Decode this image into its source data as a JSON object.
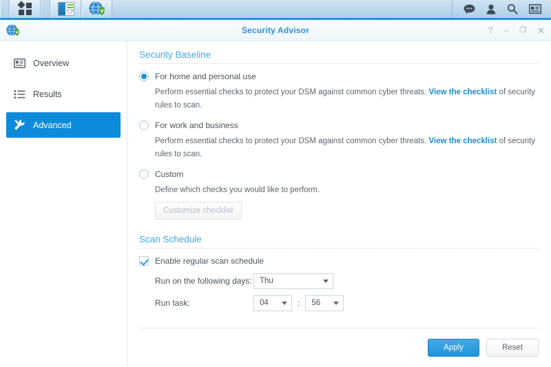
{
  "taskbar": {
    "items": [
      {
        "name": "main-menu",
        "icon": "grid-icon"
      },
      {
        "name": "file-station-window",
        "icon": "document-window-icon"
      },
      {
        "name": "security-advisor-window",
        "icon": "security-advisor-icon"
      }
    ],
    "tray": [
      {
        "name": "notifications",
        "icon": "chat-bubble-icon"
      },
      {
        "name": "user-options",
        "icon": "person-icon"
      },
      {
        "name": "search",
        "icon": "search-icon"
      },
      {
        "name": "widgets",
        "icon": "widget-card-icon"
      }
    ]
  },
  "window": {
    "title": "Security Advisor",
    "app_icon": "security-advisor-icon",
    "controls": {
      "help": "?",
      "minimize": "–",
      "maximize": "❐",
      "close": "✕"
    }
  },
  "sidebar": {
    "items": [
      {
        "label": "Overview",
        "icon": "overview-card-icon",
        "selected": false
      },
      {
        "label": "Results",
        "icon": "results-list-icon",
        "selected": false
      },
      {
        "label": "Advanced",
        "icon": "advanced-tools-icon",
        "selected": true
      }
    ]
  },
  "security_baseline": {
    "heading": "Security Baseline",
    "options": [
      {
        "label": "For home and personal use",
        "selected": true,
        "desc_before": "Perform essential checks to protect your DSM against common cyber threats. ",
        "desc_link": "View the checklist",
        "desc_after": " of security rules to scan."
      },
      {
        "label": "For work and business",
        "selected": false,
        "desc_before": "Perform essential checks to protect your DSM against common cyber threats. ",
        "desc_link": "View the checklist",
        "desc_after": " of security rules to scan."
      },
      {
        "label": "Custom",
        "selected": false,
        "desc_before": "Define which checks you would like to perform.",
        "desc_link": "",
        "desc_after": ""
      }
    ],
    "customize_button": "Customize checklist"
  },
  "scan_schedule": {
    "heading": "Scan Schedule",
    "enable_label": "Enable regular scan schedule",
    "enable_checked": true,
    "days_label": "Run on the following days:",
    "days_value": "Thu",
    "task_label": "Run task:",
    "hour_value": "04",
    "minute_value": "56",
    "time_separator": ":"
  },
  "footer": {
    "apply_label": "Apply",
    "reset_label": "Reset"
  },
  "colors": {
    "accent": "#0d8bdb",
    "heading": "#4aa8e0",
    "link": "#1c8ad6",
    "taskbar_border": "#2196dc"
  }
}
